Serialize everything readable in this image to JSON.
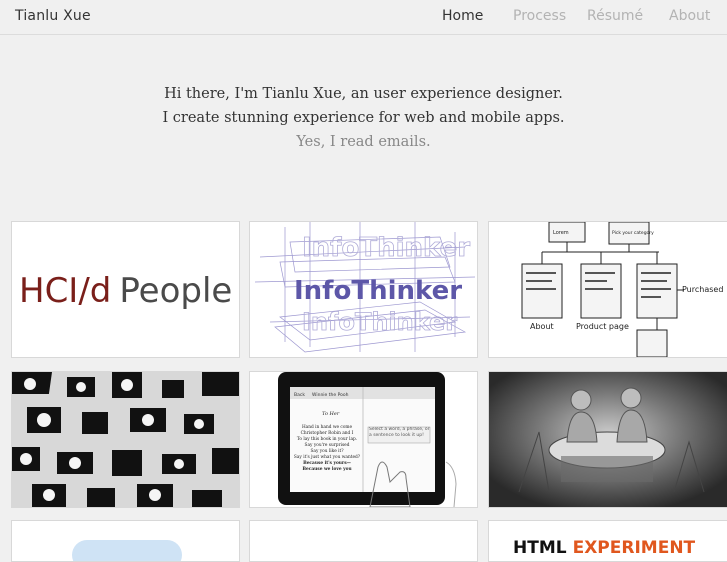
{
  "header": {
    "brand": "Tianlu Xue",
    "nav": [
      {
        "label": "Home",
        "active": true
      },
      {
        "label": "Process",
        "active": false
      },
      {
        "label": "Résumé",
        "active": false
      },
      {
        "label": "About",
        "active": false
      }
    ]
  },
  "intro": {
    "line1": "Hi there, I'm Tianlu Xue, an user experience designer.",
    "line2": "I create stunning experience for web and mobile apps.",
    "line3": "Yes, I read emails."
  },
  "tiles": {
    "hci": {
      "part1": "HCI/d",
      "part2": "People"
    },
    "infothinker": {
      "label": "InfoThinker",
      "ghost": "InfoThinker"
    },
    "flow": {
      "about": "About",
      "product": "Product page",
      "purchased": "Purchased",
      "box1": "Lorem",
      "box2": "Pick your category"
    },
    "ipad": {
      "back": "Back",
      "title": "Winnie the Pooh",
      "poem_title": "To Her",
      "poem": [
        "Hand in hand we come",
        "Christopher Robin and I",
        "To lay this book in your lap.",
        "Say you're surprised",
        "Say you like it?",
        "Say it's just what you wanted?",
        "Because it's yours—",
        "Because we love you"
      ],
      "note": "Select a word, a phrase, or a sentence to look it up!"
    },
    "html": {
      "part1": "HTML",
      "part2": "EXPERIMENT"
    }
  }
}
